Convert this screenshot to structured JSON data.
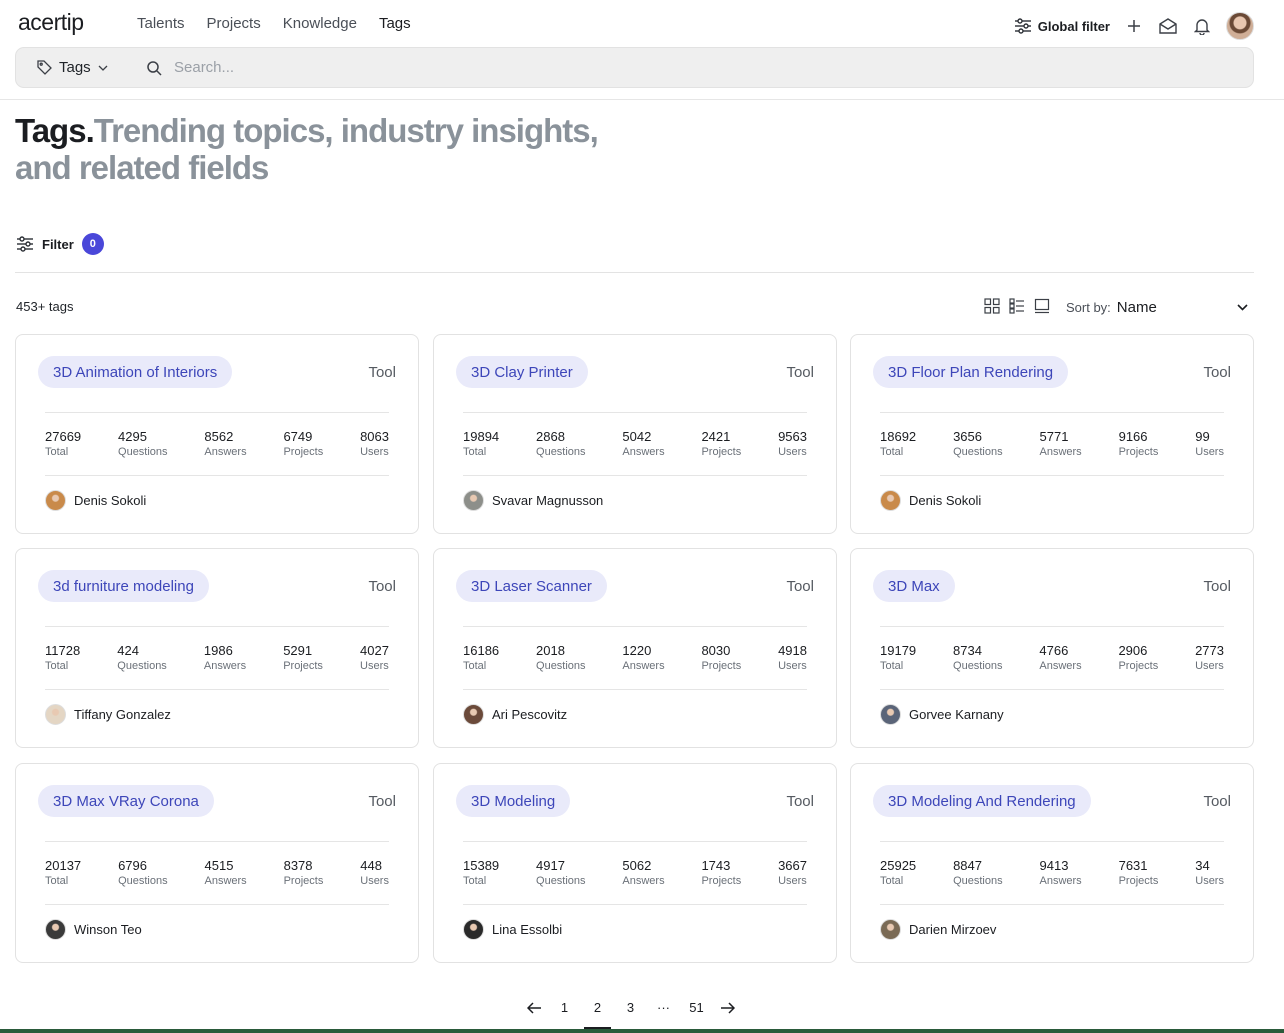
{
  "app": {
    "logo": "acertip",
    "nav": [
      "Talents",
      "Projects",
      "Knowledge",
      "Tags"
    ],
    "active_nav": 3,
    "global_filter_label": "Global filter"
  },
  "search": {
    "scope_label": "Tags",
    "placeholder": "Search..."
  },
  "page": {
    "title": "Tags.",
    "subtitle": "Trending topics, industry insights, and related fields",
    "filter_label": "Filter",
    "filter_count": "0",
    "result_count": "453+ tags",
    "sort_label": "Sort by:",
    "sort_value": "Name"
  },
  "cards": [
    {
      "name": "3D Animation of Interiors",
      "type": "Tool",
      "total": "27669",
      "questions": "4295",
      "answers": "8562",
      "projects": "6749",
      "users": "8063",
      "owner": "Denis Sokoli",
      "avatar_color": "#c98a4a"
    },
    {
      "name": "3D Clay Printer",
      "type": "Tool",
      "total": "19894",
      "questions": "2868",
      "answers": "5042",
      "projects": "2421",
      "users": "9563",
      "owner": "Svavar Magnusson",
      "avatar_color": "#8d8f8a"
    },
    {
      "name": "3D Floor Plan Rendering",
      "type": "Tool",
      "total": "18692",
      "questions": "3656",
      "answers": "5771",
      "projects": "9166",
      "users": "99",
      "owner": "Denis Sokoli",
      "avatar_color": "#c98a4a"
    },
    {
      "name": "3d furniture modeling",
      "type": "Tool",
      "total": "11728",
      "questions": "424",
      "answers": "1986",
      "projects": "5291",
      "users": "4027",
      "owner": "Tiffany Gonzalez",
      "avatar_color": "#e4d6c4"
    },
    {
      "name": "3D Laser Scanner",
      "type": "Tool",
      "total": "16186",
      "questions": "2018",
      "answers": "1220",
      "projects": "8030",
      "users": "4918",
      "owner": "Ari Pescovitz",
      "avatar_color": "#6b4a3a"
    },
    {
      "name": "3D Max",
      "type": "Tool",
      "total": "19179",
      "questions": "8734",
      "answers": "4766",
      "projects": "2906",
      "users": "2773",
      "owner": "Gorvee Karnany",
      "avatar_color": "#5a6478"
    },
    {
      "name": "3D Max VRay Corona",
      "type": "Tool",
      "total": "20137",
      "questions": "6796",
      "answers": "4515",
      "projects": "8378",
      "users": "448",
      "owner": "Winson Teo",
      "avatar_color": "#3a3a3a"
    },
    {
      "name": "3D Modeling",
      "type": "Tool",
      "total": "15389",
      "questions": "4917",
      "answers": "5062",
      "projects": "1743",
      "users": "3667",
      "owner": "Lina Essolbi",
      "avatar_color": "#2a2a2a"
    },
    {
      "name": "3D Modeling And Rendering",
      "type": "Tool",
      "total": "25925",
      "questions": "8847",
      "answers": "9413",
      "projects": "7631",
      "users": "34",
      "owner": "Darien Mirzoev",
      "avatar_color": "#7a6a55"
    }
  ],
  "stat_labels": {
    "total": "Total",
    "questions": "Questions",
    "answers": "Answers",
    "projects": "Projects",
    "users": "Users"
  },
  "pagination": {
    "pages": [
      "1",
      "2",
      "3",
      "···",
      "51"
    ],
    "active": 1
  }
}
